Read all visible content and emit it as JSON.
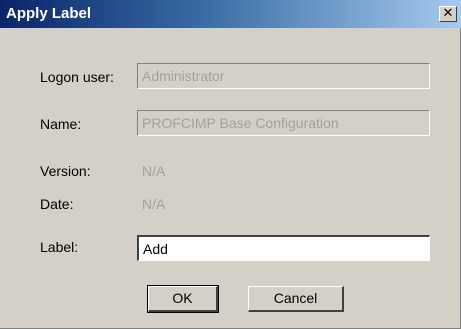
{
  "window": {
    "title": "Apply Label",
    "close_glyph": "✕"
  },
  "form": {
    "logon_user_label": "Logon user:",
    "logon_user_value": "Administrator",
    "name_label": "Name:",
    "name_value": "PROFCIMP Base Configuration",
    "version_label": "Version:",
    "version_value": "N/A",
    "date_label": "Date:",
    "date_value": "N/A",
    "label_label": "Label:",
    "label_value": "Add"
  },
  "buttons": {
    "ok_label": "OK",
    "cancel_label": "Cancel"
  }
}
